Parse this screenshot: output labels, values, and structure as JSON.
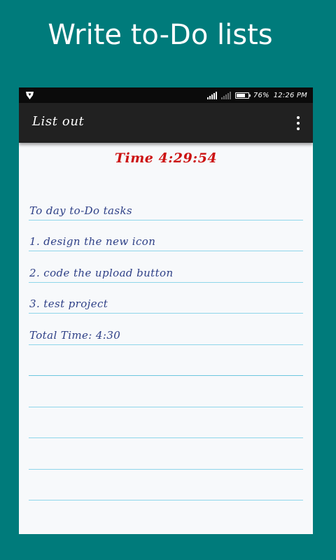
{
  "promo": {
    "title": "Write to-Do lists"
  },
  "status_bar": {
    "battery_percent": "76%",
    "battery_level": 0.76,
    "time": "12:26 PM",
    "left_icon": "notification-shield-icon",
    "signal_icon": "cell-signal-icon",
    "battery_icon": "battery-icon"
  },
  "app_bar": {
    "title": "List out",
    "menu_icon": "more-vert-icon"
  },
  "timer": {
    "text": "Time 4:29:54",
    "color": "#cc1111"
  },
  "notes": {
    "lines": [
      "To day to-Do tasks",
      "1.  design the new icon",
      "2. code the upload button",
      "3. test project",
      "Total Time: 4:30",
      "",
      "",
      "",
      "",
      ""
    ],
    "text_color": "#2d3f86",
    "rule_color": "#8fd6ea"
  },
  "colors": {
    "background": "#007b7b",
    "app_bar": "#212121",
    "status_bar": "#0b0b0b",
    "paper": "#f7f9fb"
  }
}
